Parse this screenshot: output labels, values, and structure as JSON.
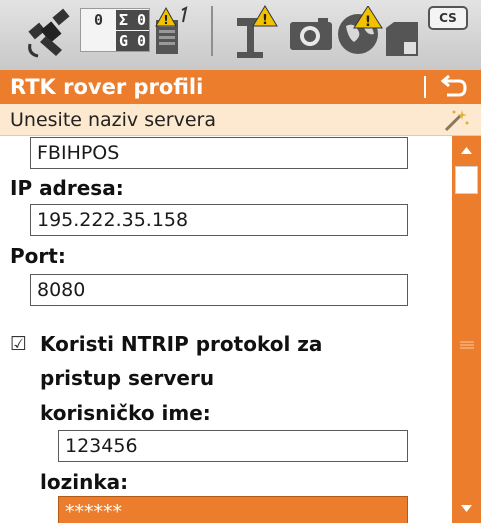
{
  "statusbar": {
    "icons": [
      "satellite-icon",
      "satellite-count-box",
      "battery-warning-icon",
      "rtk-antenna-warning-icon",
      "camera-icon",
      "globe-warning-icon",
      "memory-card-icon",
      "cs-keyboard-icon"
    ],
    "counts": {
      "gps_label": "G",
      "gps_value": "0",
      "sum_label": "Σ",
      "sum_value": "0",
      "blank_value": "0"
    },
    "cs_label": "CS"
  },
  "title": {
    "text": "RTK rover profili"
  },
  "hint": {
    "text": "Unesite naziv servera"
  },
  "form": {
    "server_name": {
      "value": "FBIHPOS"
    },
    "ip": {
      "label": "IP adresa:",
      "value": "195.222.35.158"
    },
    "port": {
      "label": "Port:",
      "value": "8080"
    },
    "ntrip": {
      "checked": true,
      "check_glyph": "☑",
      "label_line1": "Koristi NTRIP protokol za",
      "label_line2": "pristup serveru"
    },
    "username": {
      "label": "korisničko ime:",
      "value": "123456"
    },
    "password": {
      "label": "lozinka:",
      "value": "******"
    }
  },
  "colors": {
    "accent": "#ec7d2c",
    "hint_bg": "#fde9cf",
    "statusbar_bg": "#d2d2d2",
    "warning": "#f2c200"
  },
  "scrollbar": {
    "position": 0.05
  }
}
